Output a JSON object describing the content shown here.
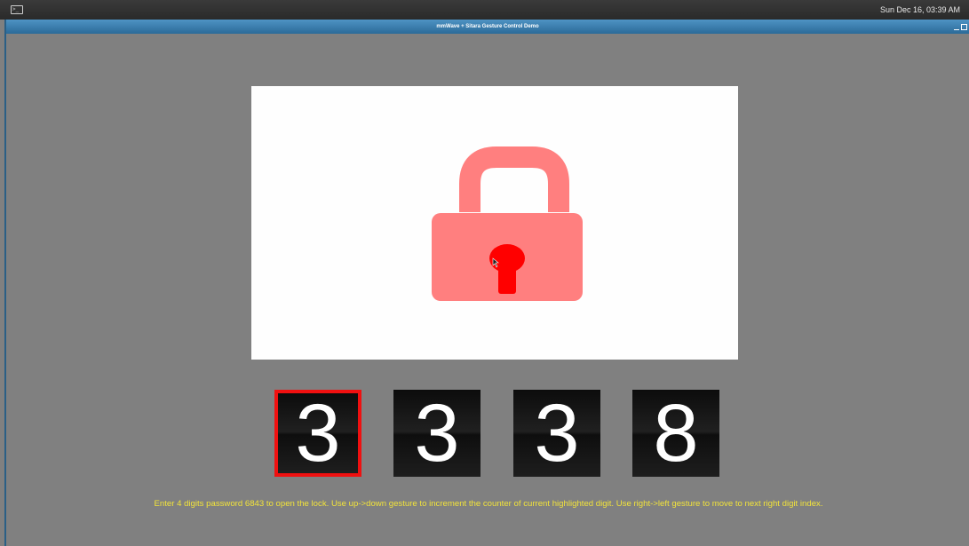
{
  "desktop": {
    "terminal_icon_glyph": ">_",
    "clock": "Sun Dec 16, 03:39 AM"
  },
  "window": {
    "title": "mmWave + Sitara Gesture Control Demo"
  },
  "lock": {
    "state": "locked",
    "body_color": "#ff7f7f",
    "keyhole_color": "#ff0000"
  },
  "digits": [
    {
      "value": "3",
      "highlighted": true
    },
    {
      "value": "3",
      "highlighted": false
    },
    {
      "value": "3",
      "highlighted": false
    },
    {
      "value": "8",
      "highlighted": false
    }
  ],
  "instruction": "Enter 4 digits password 6843 to open the lock. Use up->down gesture to increment the counter of current highlighted digit. Use right->left gesture to move to next right digit index."
}
